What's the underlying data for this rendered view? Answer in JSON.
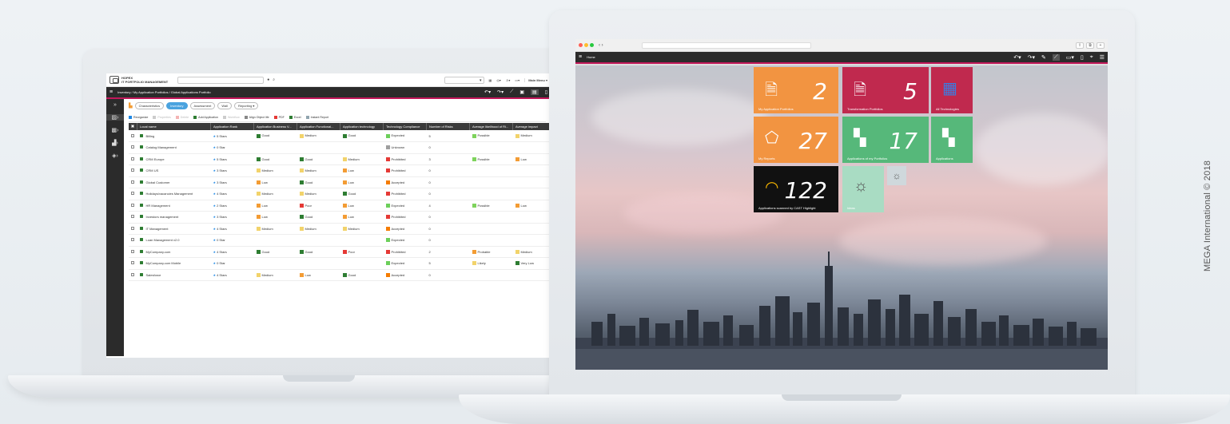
{
  "copyright": "MEGA International © 2018",
  "left_app": {
    "brand_line1": "HOPEX",
    "brand_line2": "IT PORTFOLIO MANAGEMENT",
    "main_menu": "Main Menu",
    "breadcrumb": "Inventory / My Application Portfolios / Global Applications Portfolio",
    "tabs": [
      "Characteristics",
      "Inventory",
      "Assessment",
      "Wall",
      "Reporting"
    ],
    "toolbar": [
      "Reorganize",
      "Properties",
      "Delete",
      "Add Application",
      "Workflow",
      "Align Object life",
      "PDF",
      "Excel",
      "Instant Report"
    ],
    "columns": [
      "Local name",
      "Application Rank",
      "Application Business V...",
      "Application Functional...",
      "Application technology",
      "Technology Compliance",
      "Number of Risks",
      "Average likelihood of Ri...",
      "Average impact"
    ],
    "rows": [
      {
        "name": "Billing",
        "rank": "5 Stars",
        "biz": "Good",
        "func": "Medium",
        "tech": "Good",
        "comp": "Expected",
        "risks": "5",
        "like": "Possible",
        "impact": "Medium"
      },
      {
        "name": "Catalog Management",
        "rank": "0 Star",
        "biz": "",
        "func": "",
        "tech": "",
        "comp": "Unknown",
        "risks": "0",
        "like": "",
        "impact": ""
      },
      {
        "name": "CRM Europe",
        "rank": "5 Stars",
        "biz": "Good",
        "func": "Good",
        "tech": "Medium",
        "comp": "Prohibited",
        "risks": "3",
        "like": "Possible",
        "impact": "Low"
      },
      {
        "name": "CRM US",
        "rank": "3 Stars",
        "biz": "Medium",
        "func": "Medium",
        "tech": "Low",
        "comp": "Prohibited",
        "risks": "0",
        "like": "",
        "impact": ""
      },
      {
        "name": "Global Customer",
        "rank": "3 Stars",
        "biz": "Low",
        "func": "Good",
        "tech": "Low",
        "comp": "Accepted",
        "risks": "0",
        "like": "",
        "impact": ""
      },
      {
        "name": "Holidays/vacancies Management",
        "rank": "4 Stars",
        "biz": "Medium",
        "func": "Medium",
        "tech": "Good",
        "comp": "Prohibited",
        "risks": "0",
        "like": "",
        "impact": ""
      },
      {
        "name": "HR Management",
        "rank": "2 Stars",
        "biz": "Low",
        "func": "Poor",
        "tech": "Low",
        "comp": "Expected",
        "risks": "4",
        "like": "Possible",
        "impact": "Low"
      },
      {
        "name": "Investors management",
        "rank": "3 Stars",
        "biz": "Low",
        "func": "Good",
        "tech": "Low",
        "comp": "Prohibited",
        "risks": "0",
        "like": "",
        "impact": ""
      },
      {
        "name": "IT Management",
        "rank": "4 Stars",
        "biz": "Medium",
        "func": "Medium",
        "tech": "Medium",
        "comp": "Accepted",
        "risks": "0",
        "like": "",
        "impact": ""
      },
      {
        "name": "Loan Management v2.0",
        "rank": "0 Star",
        "biz": "",
        "func": "",
        "tech": "",
        "comp": "Expected",
        "risks": "0",
        "like": "",
        "impact": ""
      },
      {
        "name": "MyCompany.com",
        "rank": "4 Stars",
        "biz": "Good",
        "func": "Good",
        "tech": "Poor",
        "comp": "Prohibited",
        "risks": "2",
        "like": "Probable",
        "impact": "Medium"
      },
      {
        "name": "MyCompany.com Mobile",
        "rank": "0 Star",
        "biz": "",
        "func": "",
        "tech": "",
        "comp": "Expected",
        "risks": "5",
        "like": "Likely",
        "impact": "Very Low"
      },
      {
        "name": "Salesforce",
        "rank": "4 Stars",
        "biz": "Medium",
        "func": "Low",
        "tech": "Good",
        "comp": "Accepted",
        "risks": "0",
        "like": "",
        "impact": ""
      }
    ],
    "level_colors": {
      "Good": "#2e7d32",
      "Medium": "#f2d36b",
      "Low": "#f39c34",
      "Poor": "#e53935",
      "Expected": "#6ccf5a",
      "Unknown": "#9e9e9e",
      "Prohibited": "#e53935",
      "Accepted": "#f57c00",
      "Possible": "#7ed35c",
      "Probable": "#f39c34",
      "Likely": "#f2d36b",
      "Very Low": "#2e7d32"
    }
  },
  "right_app": {
    "home_label": "Home",
    "tiles": [
      {
        "label": "My Application Portfolios",
        "value": "2",
        "color": "#f29441",
        "icon": "document-icon"
      },
      {
        "label": "Transformation Portfolios",
        "value": "5",
        "color": "#c0294e",
        "icon": "document-icon"
      },
      {
        "label": "All Technologies",
        "value": "",
        "color": "#c0294e",
        "icon": "technologies-icon"
      },
      {
        "label": "My Reports",
        "value": "27",
        "color": "#f29441",
        "icon": "report-icon"
      },
      {
        "label": "Applications of my Portfolios",
        "value": "17",
        "color": "#56b87a",
        "icon": "puzzle-icon"
      },
      {
        "label": "Applications",
        "value": "",
        "color": "#56b87a",
        "icon": "puzzle-icon"
      },
      {
        "label": "Applications scanned by CAST Highlight",
        "value": "122",
        "color": "#111111",
        "icon": "cast-icon"
      },
      {
        "label": "Ideas",
        "value": "",
        "color": "#a9dcc3",
        "icon": "lightbulb-icon"
      }
    ]
  }
}
